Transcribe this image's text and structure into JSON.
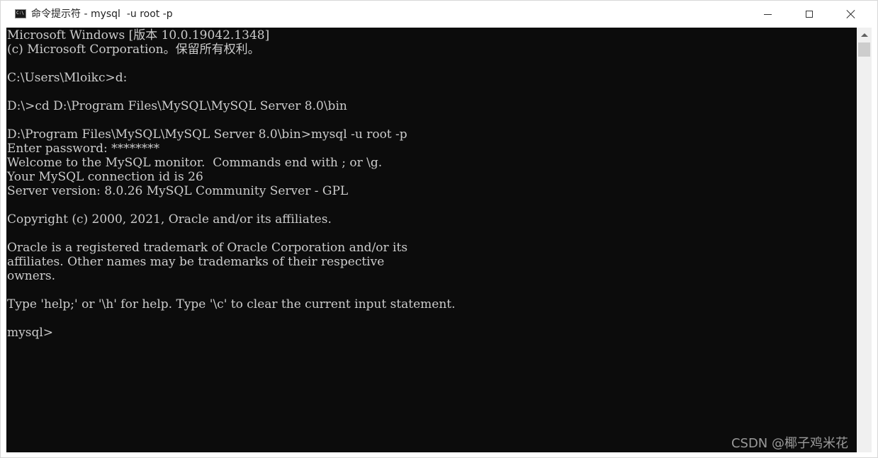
{
  "window": {
    "title": "命令提示符 - mysql  -u root -p",
    "icon": "cmd-console-icon",
    "controls": {
      "minimize_icon": "minimize-icon",
      "maximize_icon": "maximize-icon",
      "close_icon": "close-icon"
    }
  },
  "terminal": {
    "background": "#0c0c0c",
    "foreground": "#cccccc",
    "lines": [
      "Microsoft Windows [版本 10.0.19042.1348]",
      "(c) Microsoft Corporation。保留所有权利。",
      "",
      "C:\\Users\\Mloikc>d:",
      "",
      "D:\\>cd D:\\Program Files\\MySQL\\MySQL Server 8.0\\bin",
      "",
      "D:\\Program Files\\MySQL\\MySQL Server 8.0\\bin>mysql -u root -p",
      "Enter password: ********",
      "Welcome to the MySQL monitor.  Commands end with ; or \\g.",
      "Your MySQL connection id is 26",
      "Server version: 8.0.26 MySQL Community Server - GPL",
      "",
      "Copyright (c) 2000, 2021, Oracle and/or its affiliates.",
      "",
      "Oracle is a registered trademark of Oracle Corporation and/or its",
      "affiliates. Other names may be trademarks of their respective",
      "owners.",
      "",
      "Type 'help;' or '\\h' for help. Type '\\c' to clear the current input statement.",
      "",
      "mysql>"
    ]
  },
  "watermark": "CSDN @椰子鸡米花"
}
